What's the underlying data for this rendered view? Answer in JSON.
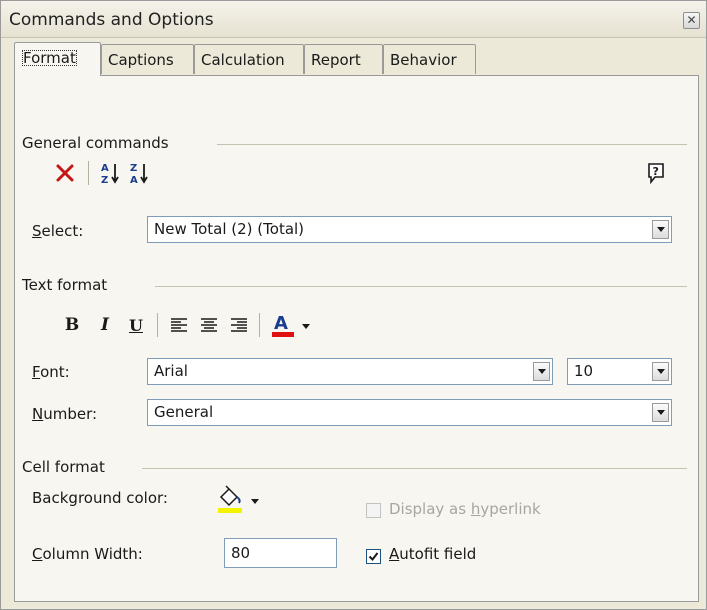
{
  "window": {
    "title": "Commands and Options",
    "close_glyph": "✕"
  },
  "tabs": [
    {
      "label": "Format",
      "active": true
    },
    {
      "label": "Captions"
    },
    {
      "label": "Calculation"
    },
    {
      "label": "Report"
    },
    {
      "label": "Behavior"
    }
  ],
  "general_commands": {
    "group_label": "General commands",
    "select_label_access": "S",
    "select_label_rest": "elect:",
    "select_value": "New Total (2) (Total)",
    "icons": [
      "delete-icon",
      "sort-ascending-icon",
      "sort-descending-icon",
      "help-icon"
    ]
  },
  "text_format": {
    "group_label": "Text format",
    "bold": "B",
    "italic": "I",
    "underline": "U",
    "font_label_access": "F",
    "font_label_rest": "ont:",
    "font_value": "Arial",
    "size_value": "10",
    "number_label_access": "N",
    "number_label_rest": "umber:",
    "number_value": "General",
    "font_color": "#e01010"
  },
  "cell_format": {
    "group_label": "Cell format",
    "background_label": "Background color:",
    "background_color": "#f4f400",
    "hyperlink_pre": "Display as ",
    "hyperlink_access": "h",
    "hyperlink_post": "yperlink",
    "hyperlink_checked": false,
    "hyperlink_disabled": true,
    "column_width_access": "C",
    "column_width_rest": "olumn Width:",
    "column_width_value": "80",
    "autofit_access": "A",
    "autofit_rest": "utofit field",
    "autofit_checked": true
  }
}
